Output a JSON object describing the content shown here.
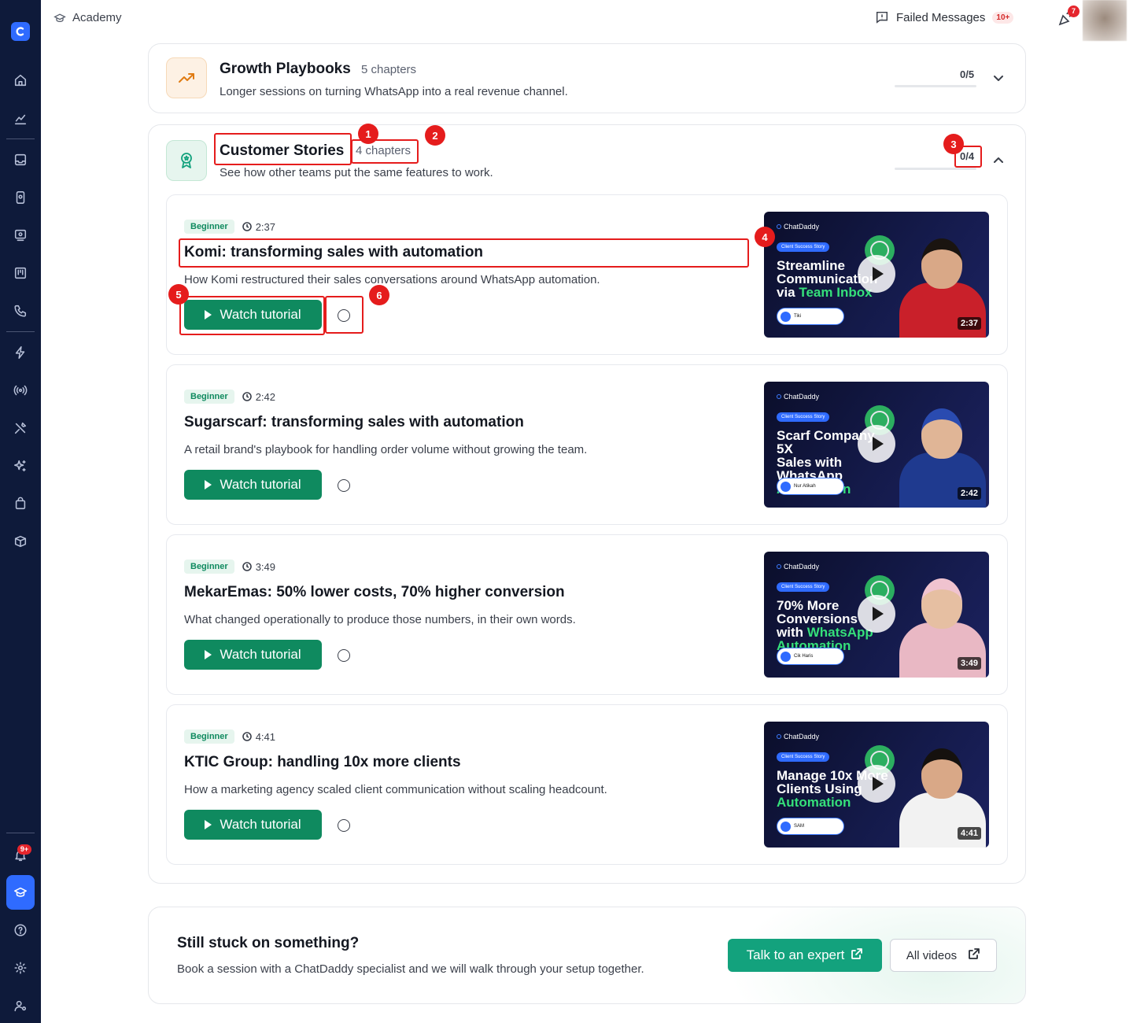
{
  "topbar": {
    "breadcrumb": "Academy",
    "failed_messages": "Failed Messages",
    "failed_badge": "10+",
    "notif_badge": "7"
  },
  "sidebar": {
    "badge": "9+"
  },
  "sections": [
    {
      "title": "Growth Playbooks",
      "count": "5 chapters",
      "description": "Longer sessions on turning WhatsApp into a real revenue channel.",
      "progress": "0/5",
      "progress_fraction": 0,
      "expanded": false
    },
    {
      "title": "Customer Stories",
      "count": "4 chapters",
      "description": "See how other teams put the same features to work.",
      "progress": "0/4",
      "progress_fraction": 0,
      "expanded": true
    }
  ],
  "lessons": [
    {
      "level": "Beginner",
      "duration": "2:37",
      "title": "Komi: transforming sales with automation",
      "description": "How Komi restructured their sales conversations around WhatsApp automation.",
      "button": "Watch tutorial",
      "thumb": {
        "brand": "ChatDaddy",
        "pill": "Client Success Story",
        "line1": "Streamline",
        "line2": "Communication",
        "line3a": "via ",
        "line3b": "Team Inbox",
        "presenter": "Tiki",
        "duration": "2:37",
        "shirt": "#c9202a",
        "skin": "#d9a887",
        "hair": "#1a1410"
      }
    },
    {
      "level": "Beginner",
      "duration": "2:42",
      "title": "Sugarscarf: transforming sales with automation",
      "description": "A retail brand's playbook for handling order volume without growing the team.",
      "button": "Watch tutorial",
      "thumb": {
        "brand": "ChatDaddy",
        "pill": "Client Success Story",
        "line1": "Scarf Company 5X",
        "line2": "Sales with WhatsApp",
        "line3a": "",
        "line3b": "Automation",
        "presenter": "Nur Atikah",
        "duration": "2:42",
        "shirt": "#1f3a8f",
        "skin": "#e0b596",
        "hair": "#2a4bb0"
      }
    },
    {
      "level": "Beginner",
      "duration": "3:49",
      "title": "MekarEmas: 50% lower costs, 70% higher conversion",
      "description": "What changed operationally to produce those numbers, in their own words.",
      "button": "Watch tutorial",
      "thumb": {
        "brand": "ChatDaddy",
        "pill": "Client Success Story",
        "line1": "70% More",
        "line2": "Conversions",
        "line3a": "with ",
        "line3b": "WhatsApp Automation",
        "presenter": "Cik Haris",
        "duration": "3:49",
        "shirt": "#e9b8c4",
        "skin": "#e6bfa2",
        "hair": "#f0c3cf"
      }
    },
    {
      "level": "Beginner",
      "duration": "4:41",
      "title": "KTIC Group: handling 10x more clients",
      "description": "How a marketing agency scaled client communication without scaling headcount.",
      "button": "Watch tutorial",
      "thumb": {
        "brand": "ChatDaddy",
        "pill": "Client Success Story",
        "line1": "Manage 10x More",
        "line2": "Clients Using",
        "line3a": "",
        "line3b": "Automation",
        "presenter": "SAM",
        "duration": "4:41",
        "shirt": "#f2f2f2",
        "skin": "#d9a887",
        "hair": "#15110e"
      }
    }
  ],
  "help": {
    "title": "Still stuck on something?",
    "description": "Book a session with a ChatDaddy specialist and we will walk through your setup together.",
    "expert_button": "Talk to an expert",
    "videos_button": "All videos"
  },
  "annotations": [
    "1",
    "2",
    "3",
    "4",
    "5",
    "6"
  ],
  "colors": {
    "accent_green": "#0f8a5f",
    "brand_blue": "#2f6bff",
    "sidebar_bg": "#0e1a3a",
    "annotation_red": "#e51c1c"
  }
}
